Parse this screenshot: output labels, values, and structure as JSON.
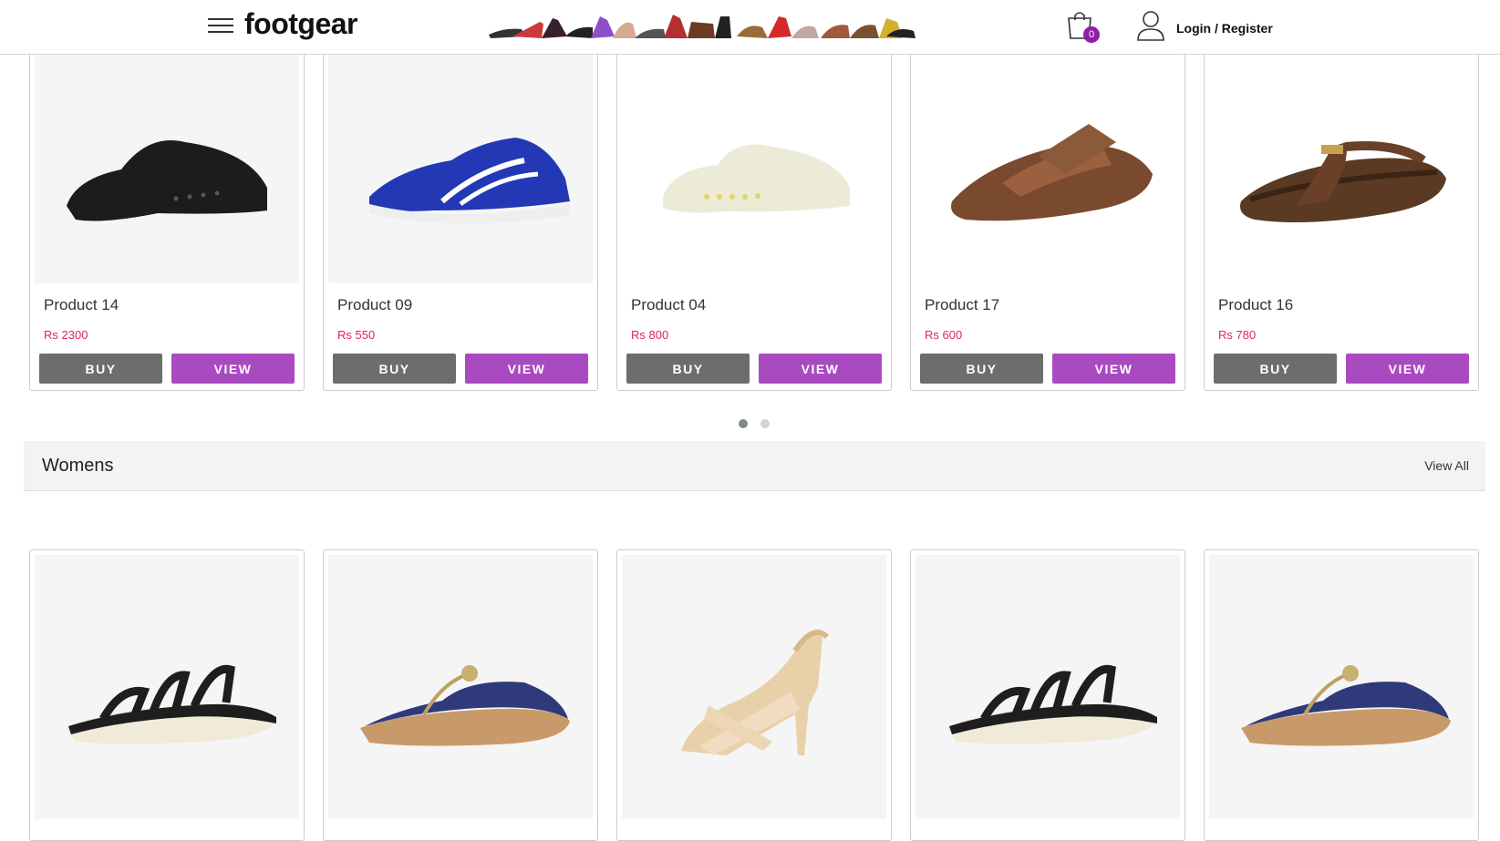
{
  "header": {
    "logo": "footgear",
    "cart_count": "0",
    "login_label": "Login / Register"
  },
  "row1": [
    {
      "name": "Product 14",
      "price": "Rs 2300",
      "buy": "BUY",
      "view": "VIEW"
    },
    {
      "name": "Product 09",
      "price": "Rs 550",
      "buy": "BUY",
      "view": "VIEW"
    },
    {
      "name": "Product 04",
      "price": "Rs 800",
      "buy": "BUY",
      "view": "VIEW"
    },
    {
      "name": "Product 17",
      "price": "Rs 600",
      "buy": "BUY",
      "view": "VIEW"
    },
    {
      "name": "Product 16",
      "price": "Rs 780",
      "buy": "BUY",
      "view": "VIEW"
    }
  ],
  "section": {
    "title": "Womens",
    "view_all": "View All"
  },
  "colors": {
    "accent": "#a94ac1",
    "buy": "#6d6d6d",
    "price": "#e0245e",
    "badge": "#8e1fa6"
  }
}
